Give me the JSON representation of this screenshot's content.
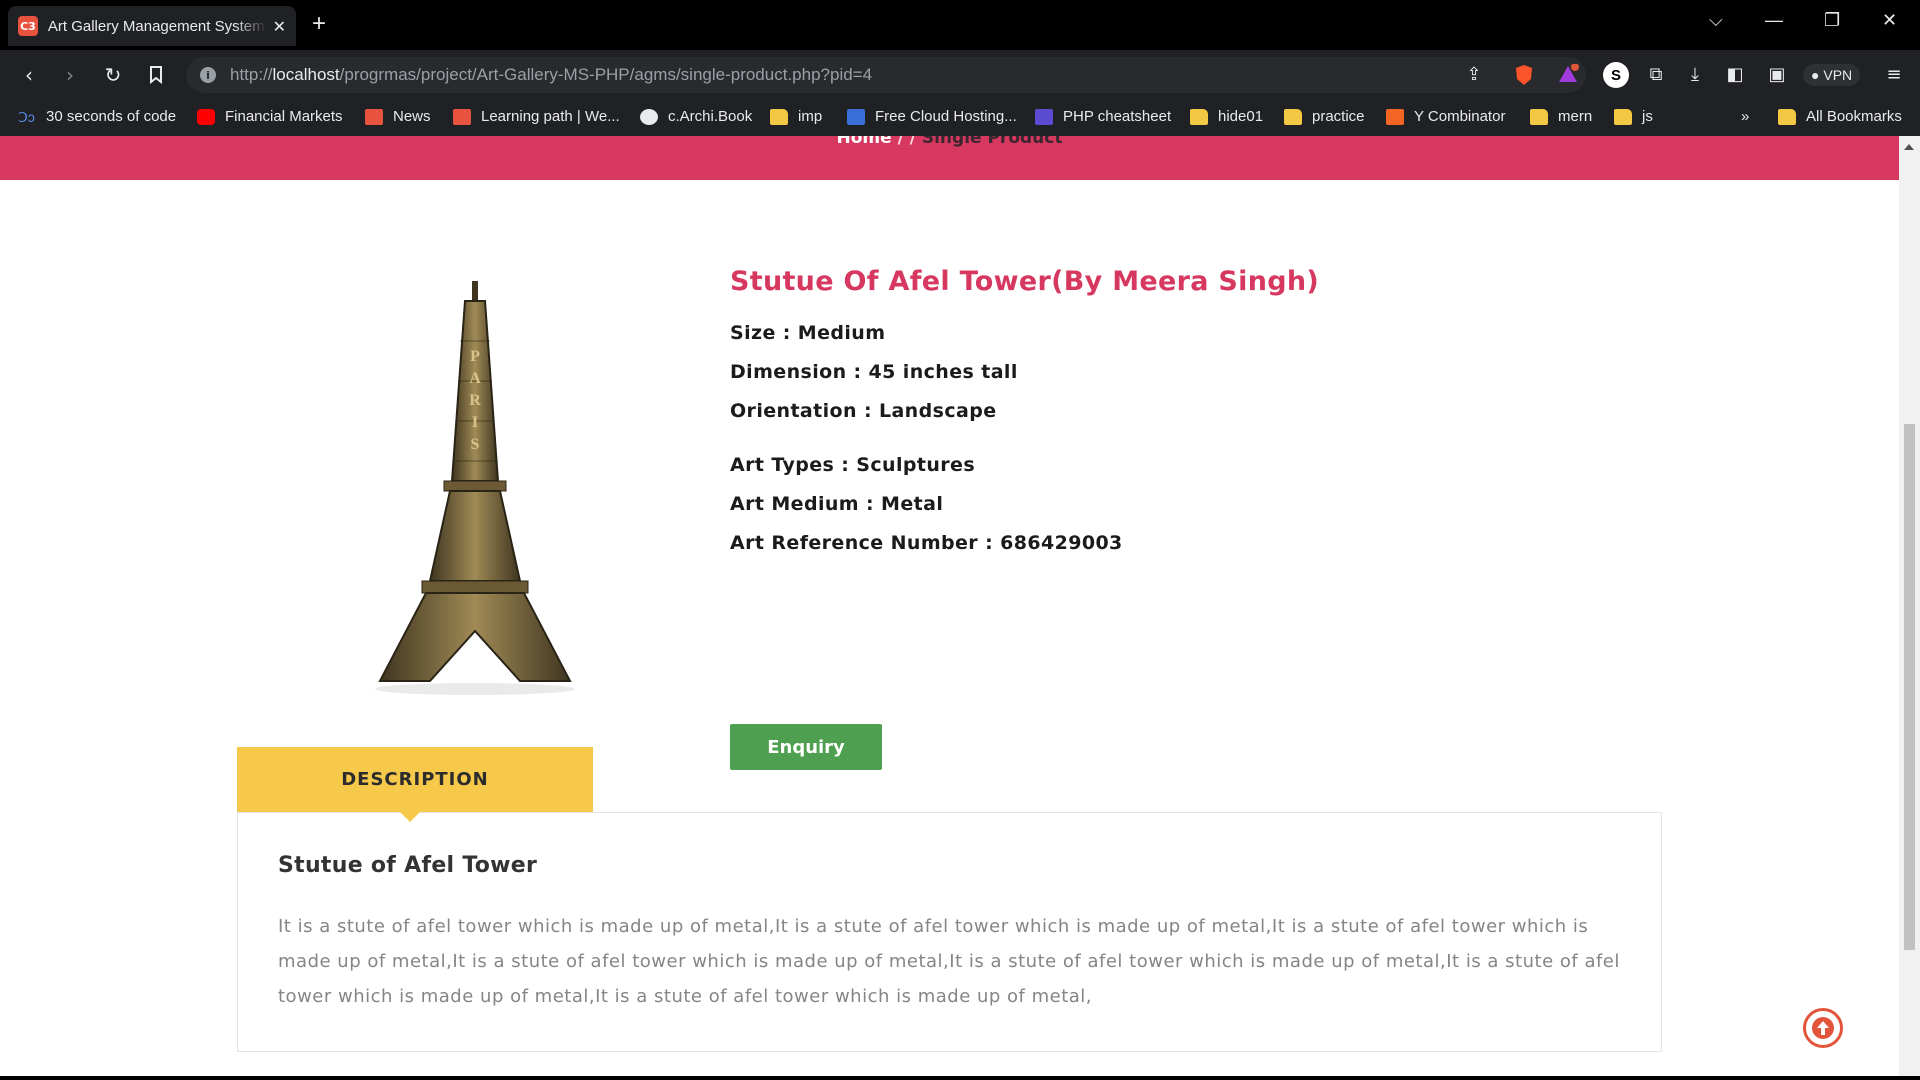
{
  "browser": {
    "tab_title": "Art Gallery Management System",
    "tab_favicon": "C3",
    "url_prefix": "http://",
    "url_host": "localhost",
    "url_path": "/progrmas/project/Art-Gallery-MS-PHP/agms/single-product.php?pid=4",
    "vpn_label": "VPN",
    "profile_initial": "S",
    "bookmarks": [
      {
        "label": "30 seconds of code",
        "icon": "code-icon"
      },
      {
        "label": "Financial Markets",
        "icon": "youtube-icon"
      },
      {
        "label": "News",
        "icon": "bolt-icon"
      },
      {
        "label": "Learning path | We...",
        "icon": "bolt-icon"
      },
      {
        "label": "c.Archi.Book",
        "icon": "globe-icon"
      },
      {
        "label": "imp",
        "icon": "folder-icon"
      },
      {
        "label": "Free Cloud Hosting...",
        "icon": "v-icon"
      },
      {
        "label": "PHP cheatsheet",
        "icon": "php-icon"
      },
      {
        "label": "hide01",
        "icon": "folder-icon"
      },
      {
        "label": "practice",
        "icon": "folder-icon"
      },
      {
        "label": "Y Combinator",
        "icon": "y-icon"
      },
      {
        "label": "mern",
        "icon": "folder-icon"
      },
      {
        "label": "js",
        "icon": "folder-icon"
      }
    ],
    "overflow": "»",
    "all_bookmarks": "All Bookmarks"
  },
  "breadcrumb": {
    "home": "Home",
    "separator": " / / ",
    "current": "Single Product"
  },
  "product": {
    "title": "Stutue Of Afel Tower(By Meera Singh)",
    "specs": [
      "Size : Medium",
      "Dimension : 45 inches tall",
      "Orientation : Landscape",
      "Art Types : Sculptures",
      "Art Medium : Metal",
      "Art Reference Number : 686429003"
    ],
    "image_text": "PARIS",
    "enquiry_label": "Enquiry"
  },
  "description": {
    "tab_label": "DESCRIPTION",
    "heading": "Stutue of Afel Tower",
    "text": "It is a stute of afel tower which is made up of metal,It is a stute of afel tower which is made up of metal,It is a stute of afel tower which is made up of metal,It is a stute of afel tower which is made up of metal,It is a stute of afel tower which is made up of metal,It is a stute of afel tower which is made up of metal,It is a stute of afel tower which is made up of metal,"
  },
  "colors": {
    "accent_pink": "#d6385f",
    "tab_yellow": "#f6c94b",
    "button_green": "#4e9f50"
  }
}
